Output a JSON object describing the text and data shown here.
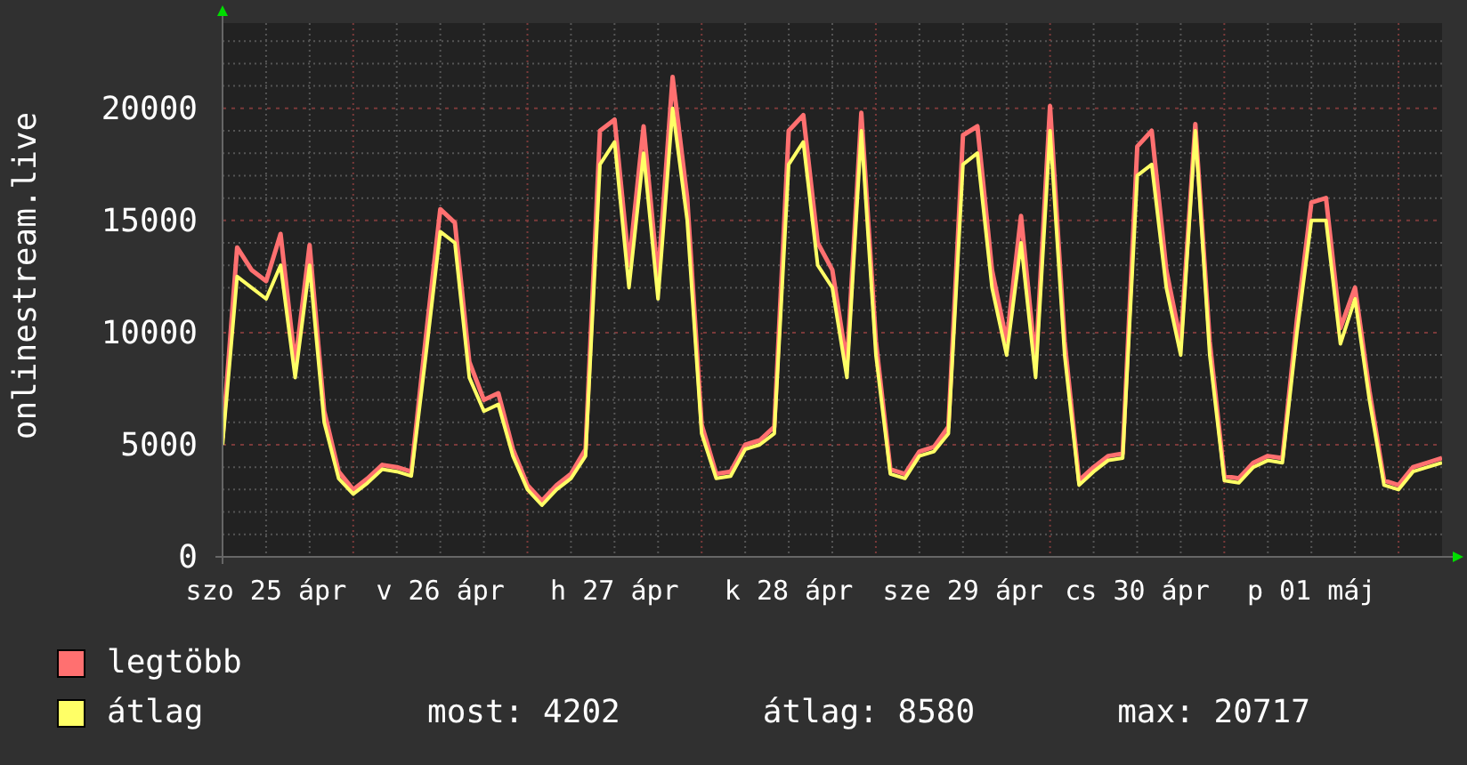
{
  "y_axis_label": "onlinestream.live",
  "chart": {
    "chart_data": {
      "type": "line",
      "grid": true,
      "categories": [
        null,
        null,
        null,
        "szo 25 ápr",
        null,
        null,
        null,
        null,
        null,
        null,
        null,
        null,
        null,
        null,
        null,
        "v 26 ápr",
        null,
        null,
        null,
        null,
        null,
        null,
        null,
        null,
        null,
        null,
        null,
        "h 27 ápr",
        null,
        null,
        null,
        null,
        null,
        null,
        null,
        null,
        null,
        null,
        null,
        "k 28 ápr",
        null,
        null,
        null,
        null,
        null,
        null,
        null,
        null,
        null,
        null,
        null,
        "sze 29 ápr",
        null,
        null,
        null,
        null,
        null,
        null,
        null,
        null,
        null,
        null,
        null,
        "cs 30 ápr",
        null,
        null,
        null,
        null,
        null,
        null,
        null,
        null,
        null,
        null,
        null,
        "p 01 máj",
        null,
        null,
        null,
        null,
        null,
        null,
        null,
        null,
        null
      ],
      "ylim": [
        0,
        23800
      ],
      "yticks": [
        0,
        5000,
        10000,
        15000,
        20000
      ],
      "series": [
        {
          "name": "legtöbb",
          "color": "#ff7070",
          "values": [
            5300,
            13800,
            12800,
            12300,
            14400,
            8600,
            13900,
            6500,
            3800,
            3000,
            3500,
            4100,
            4000,
            3800,
            9800,
            15500,
            14900,
            8700,
            7000,
            7300,
            4800,
            3200,
            2500,
            3200,
            3700,
            4800,
            19000,
            19500,
            13000,
            19200,
            12400,
            21400,
            16000,
            5900,
            3700,
            3800,
            5000,
            5200,
            5800,
            19000,
            19700,
            14000,
            12800,
            8600,
            19800,
            9600,
            3900,
            3700,
            4700,
            4900,
            5800,
            18800,
            19200,
            12800,
            9600,
            15200,
            8600,
            20100,
            9600,
            3400,
            4000,
            4500,
            4600,
            18300,
            19000,
            12800,
            9600,
            19300,
            9600,
            3600,
            3500,
            4200,
            4500,
            4400,
            10600,
            15800,
            16000,
            10200,
            12000,
            7400,
            3400,
            3200,
            4000,
            4200,
            4400
          ]
        },
        {
          "name": "átlag",
          "color": "#ffff66",
          "values": [
            5000,
            12500,
            12000,
            11500,
            13000,
            8000,
            13000,
            6000,
            3500,
            2800,
            3300,
            3900,
            3800,
            3600,
            9000,
            14500,
            14000,
            8000,
            6500,
            6800,
            4500,
            3000,
            2300,
            3000,
            3500,
            4500,
            17500,
            18500,
            12000,
            18000,
            11500,
            20000,
            15000,
            5500,
            3500,
            3600,
            4800,
            5000,
            5500,
            17500,
            18500,
            13000,
            12000,
            8000,
            19000,
            9000,
            3700,
            3500,
            4500,
            4700,
            5500,
            17500,
            18000,
            12000,
            9000,
            14000,
            8000,
            19000,
            9000,
            3200,
            3800,
            4300,
            4400,
            17000,
            17500,
            12000,
            9000,
            19000,
            9000,
            3400,
            3300,
            4000,
            4300,
            4200,
            10000,
            15000,
            15000,
            9500,
            11500,
            7000,
            3200,
            3000,
            3800,
            4000,
            4200
          ]
        }
      ]
    }
  },
  "legend_stats": [
    "most: 4202",
    "átlag: 8580",
    "max: 20717"
  ]
}
